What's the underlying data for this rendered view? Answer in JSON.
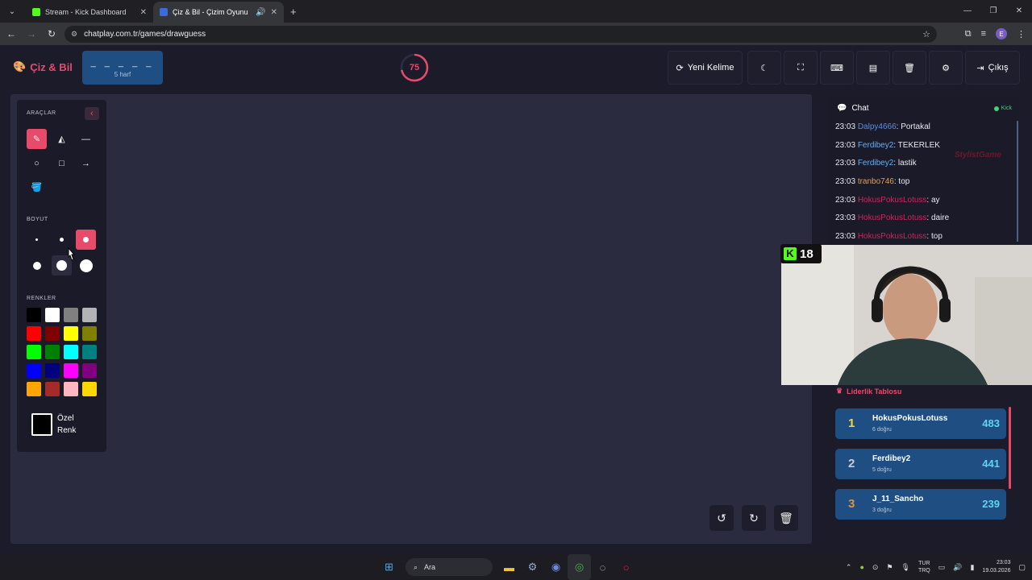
{
  "browser": {
    "tabs": [
      {
        "title": "Stream - Kick Dashboard",
        "favicon_color": "#53fc18"
      },
      {
        "title": "Çiz & Bil - Çizim Oyunu",
        "favicon_color": "#3b6bd6"
      }
    ],
    "url": "chatplay.com.tr/games/drawguess",
    "profile_initial": "E"
  },
  "header": {
    "logo": "Çiz & Bil",
    "word_mask": "_ _ _ _ _",
    "word_hint": "5 harf",
    "timer": "75",
    "timer_fraction": 0.72,
    "new_word": "Yeni Kelime",
    "exit": "Çıkış"
  },
  "tools": {
    "section_tools": "ARAÇLAR",
    "section_size": "BOYUT",
    "section_colors": "RENKLER",
    "custom_color_line1": "Özel",
    "custom_color_line2": "Renk",
    "colors": [
      "#000000",
      "#ffffff",
      "#808080",
      "#b4b4b4",
      "#ff0000",
      "#800000",
      "#ffff00",
      "#808000",
      "#00ff00",
      "#008000",
      "#00ffff",
      "#008080",
      "#0000ff",
      "#000080",
      "#ff00ff",
      "#800080",
      "#ffa500",
      "#a52a2a",
      "#ffb6c1",
      "#ffd700"
    ]
  },
  "chat": {
    "title": "Chat",
    "source": "Kick",
    "watermark": "StylistGame",
    "messages": [
      {
        "time": "23:03",
        "user": "Dalpy4666",
        "color": "#5a8ee8",
        "text": "Portakal"
      },
      {
        "time": "23:03",
        "user": "Ferdibey2",
        "color": "#6ab0f0",
        "text": "TEKERLEK"
      },
      {
        "time": "23:03",
        "user": "Ferdibey2",
        "color": "#6ab0f0",
        "text": "lastik"
      },
      {
        "time": "23:03",
        "user": "tranbo746",
        "color": "#e8a04a",
        "text": "top"
      },
      {
        "time": "23:03",
        "user": "HokusPokusLotuss",
        "color": "#d4245a",
        "text": "ay"
      },
      {
        "time": "23:03",
        "user": "HokusPokusLotuss",
        "color": "#d4245a",
        "text": "daire"
      },
      {
        "time": "23:03",
        "user": "HokusPokusLotuss",
        "color": "#d4245a",
        "text": "top"
      }
    ]
  },
  "overlay": {
    "age_rating": "18"
  },
  "leaderboard": {
    "title": "Liderlik Tablosu",
    "rows": [
      {
        "rank": "1",
        "name": "HokusPokusLotuss",
        "correct": "6 doğru",
        "score": "483",
        "rank_color": "#f5d442"
      },
      {
        "rank": "2",
        "name": "Ferdibey2",
        "correct": "5 doğru",
        "score": "441",
        "rank_color": "#c8ccd4"
      },
      {
        "rank": "3",
        "name": "J_11_Sancho",
        "correct": "3 doğru",
        "score": "239",
        "rank_color": "#e0903a"
      }
    ]
  },
  "taskbar": {
    "search": "Ara",
    "lang_top": "TUR",
    "lang_bottom": "TRQ",
    "time": "23:03",
    "date": "19.03.2026"
  },
  "accent": "#e84a6a"
}
